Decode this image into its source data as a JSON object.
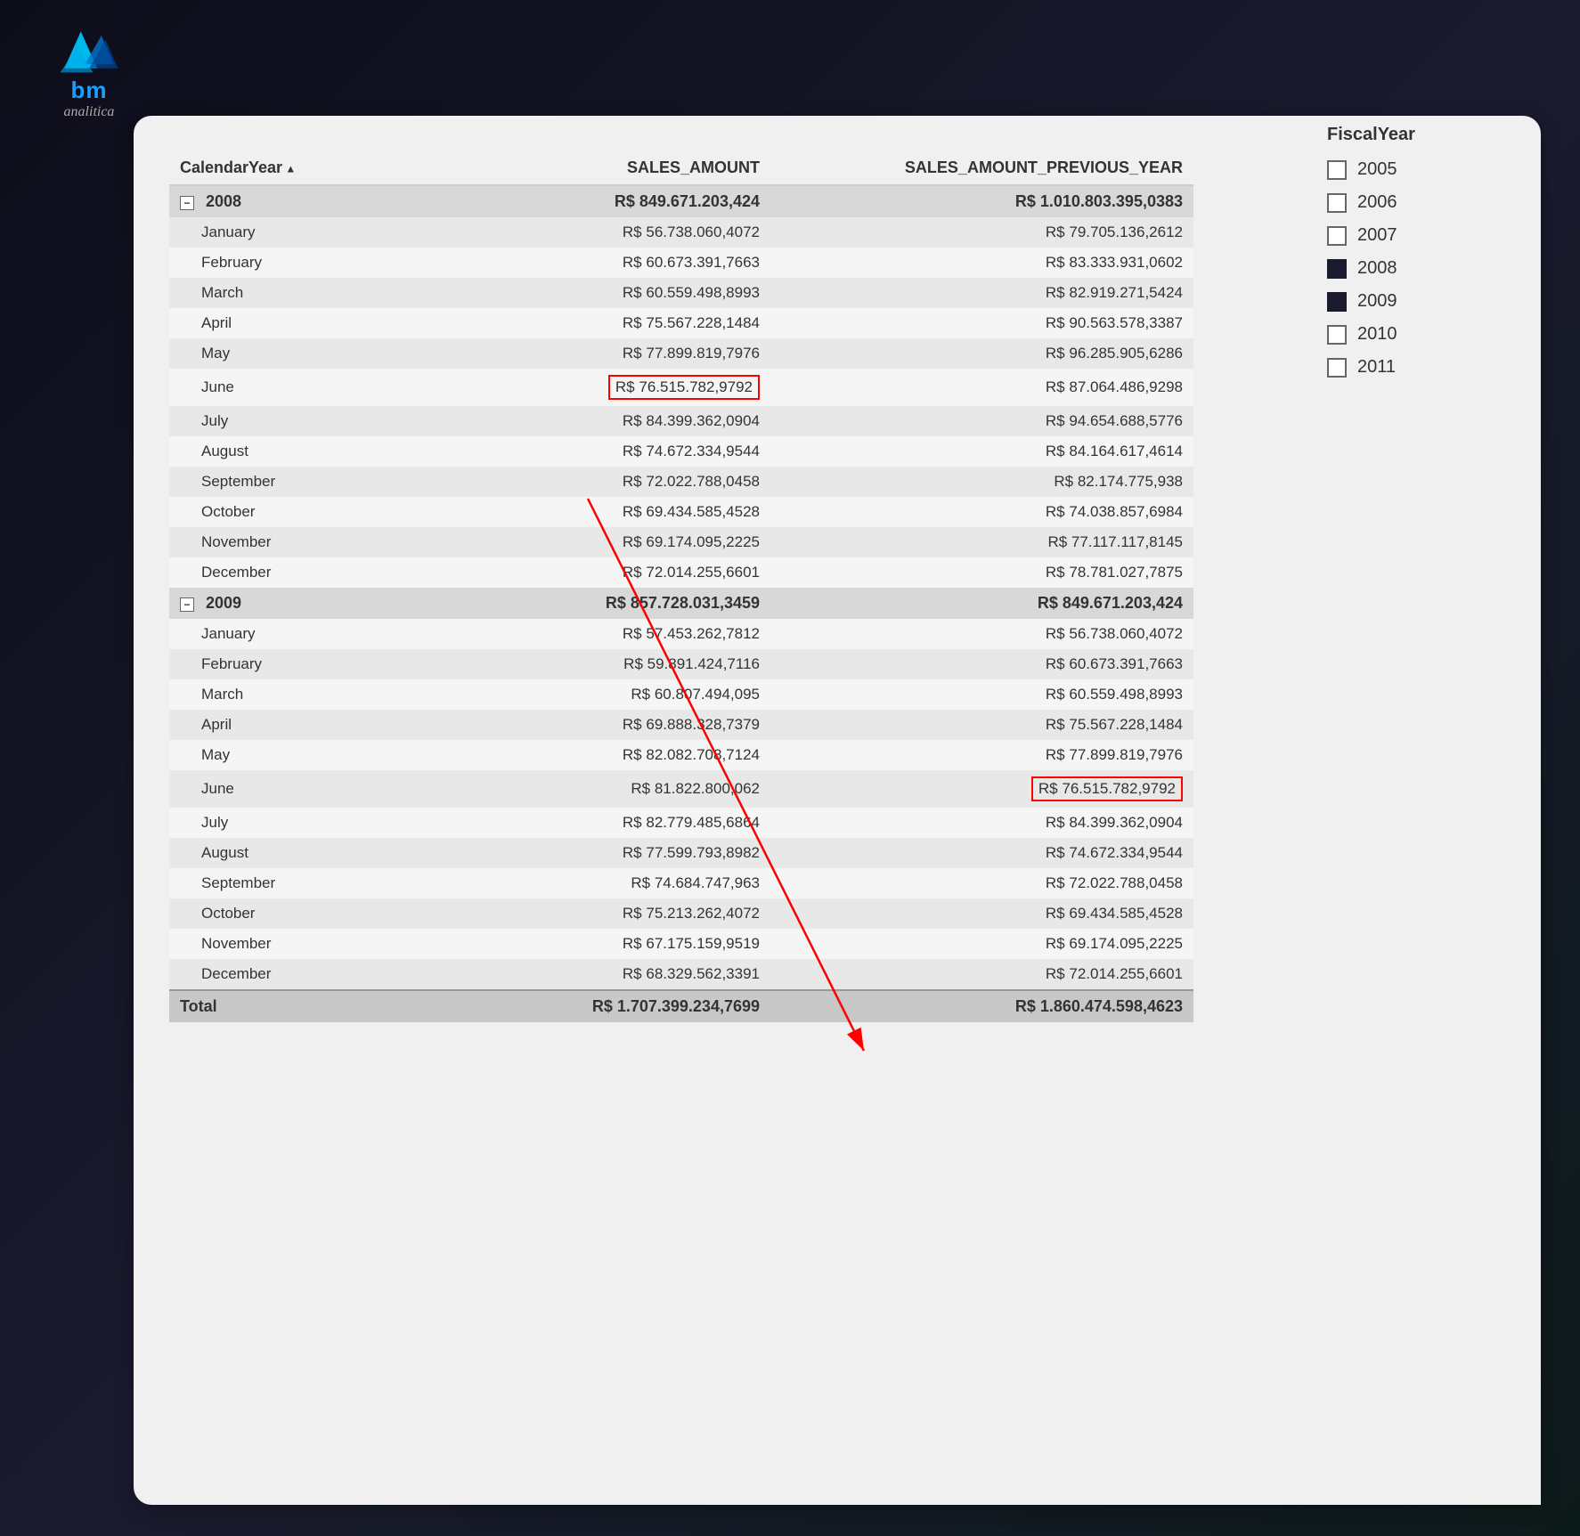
{
  "logo": {
    "brand": "bm",
    "subtitle": "analitica"
  },
  "table": {
    "headers": [
      "CalendarYear",
      "SALES_AMOUNT",
      "SALES_AMOUNT_PREVIOUS_YEAR"
    ],
    "fiscalYearTitle": "FiscalYear",
    "fiscalYears": [
      {
        "year": "2005",
        "checked": false
      },
      {
        "year": "2006",
        "checked": false
      },
      {
        "year": "2007",
        "checked": false
      },
      {
        "year": "2008",
        "checked": true
      },
      {
        "year": "2009",
        "checked": true
      },
      {
        "year": "2010",
        "checked": false
      },
      {
        "year": "2011",
        "checked": false
      }
    ],
    "rows": [
      {
        "type": "year",
        "label": "2008",
        "sales": "R$ 849.671.203,424",
        "prev": "R$ 1.010.803.395,0383"
      },
      {
        "type": "month",
        "label": "January",
        "sales": "R$ 56.738.060,4072",
        "prev": "R$ 79.705.136,2612"
      },
      {
        "type": "month",
        "label": "February",
        "sales": "R$ 60.673.391,7663",
        "prev": "R$ 83.333.931,0602"
      },
      {
        "type": "month",
        "label": "March",
        "sales": "R$ 60.559.498,8993",
        "prev": "R$ 82.919.271,5424"
      },
      {
        "type": "month",
        "label": "April",
        "sales": "R$ 75.567.228,1484",
        "prev": "R$ 90.563.578,3387"
      },
      {
        "type": "month",
        "label": "May",
        "sales": "R$ 77.899.819,7976",
        "prev": "R$ 96.285.905,6286"
      },
      {
        "type": "month",
        "label": "June",
        "sales": "R$ 76.515.782,9792",
        "prev": "R$ 87.064.486,9298",
        "highlightSales": true
      },
      {
        "type": "month",
        "label": "July",
        "sales": "R$ 84.399.362,0904",
        "prev": "R$ 94.654.688,5776"
      },
      {
        "type": "month",
        "label": "August",
        "sales": "R$ 74.672.334,9544",
        "prev": "R$ 84.164.617,4614"
      },
      {
        "type": "month",
        "label": "September",
        "sales": "R$ 72.022.788,0458",
        "prev": "R$ 82.174.775,938"
      },
      {
        "type": "month",
        "label": "October",
        "sales": "R$ 69.434.585,4528",
        "prev": "R$ 74.038.857,6984"
      },
      {
        "type": "month",
        "label": "November",
        "sales": "R$ 69.174.095,2225",
        "prev": "R$ 77.117.117,8145"
      },
      {
        "type": "month",
        "label": "December",
        "sales": "R$ 72.014.255,6601",
        "prev": "R$ 78.781.027,7875"
      },
      {
        "type": "year",
        "label": "2009",
        "sales": "R$ 857.728.031,3459",
        "prev": "R$ 849.671.203,424"
      },
      {
        "type": "month",
        "label": "January",
        "sales": "R$ 57.453.262,7812",
        "prev": "R$ 56.738.060,4072"
      },
      {
        "type": "month",
        "label": "February",
        "sales": "R$ 59.891.424,7116",
        "prev": "R$ 60.673.391,7663"
      },
      {
        "type": "month",
        "label": "March",
        "sales": "R$ 60.807.494,095",
        "prev": "R$ 60.559.498,8993"
      },
      {
        "type": "month",
        "label": "April",
        "sales": "R$ 69.888.328,7379",
        "prev": "R$ 75.567.228,1484"
      },
      {
        "type": "month",
        "label": "May",
        "sales": "R$ 82.082.708,7124",
        "prev": "R$ 77.899.819,7976"
      },
      {
        "type": "month",
        "label": "June",
        "sales": "R$ 81.822.800,062",
        "prev": "R$ 76.515.782,9792",
        "highlightPrev": true
      },
      {
        "type": "month",
        "label": "July",
        "sales": "R$ 82.779.485,6864",
        "prev": "R$ 84.399.362,0904"
      },
      {
        "type": "month",
        "label": "August",
        "sales": "R$ 77.599.793,8982",
        "prev": "R$ 74.672.334,9544"
      },
      {
        "type": "month",
        "label": "September",
        "sales": "R$ 74.684.747,963",
        "prev": "R$ 72.022.788,0458"
      },
      {
        "type": "month",
        "label": "October",
        "sales": "R$ 75.213.262,4072",
        "prev": "R$ 69.434.585,4528"
      },
      {
        "type": "month",
        "label": "November",
        "sales": "R$ 67.175.159,9519",
        "prev": "R$ 69.174.095,2225"
      },
      {
        "type": "month",
        "label": "December",
        "sales": "R$ 68.329.562,3391",
        "prev": "R$ 72.014.255,6601"
      },
      {
        "type": "total",
        "label": "Total",
        "sales": "R$ 1.707.399.234,7699",
        "prev": "R$ 1.860.474.598,4623"
      }
    ]
  }
}
